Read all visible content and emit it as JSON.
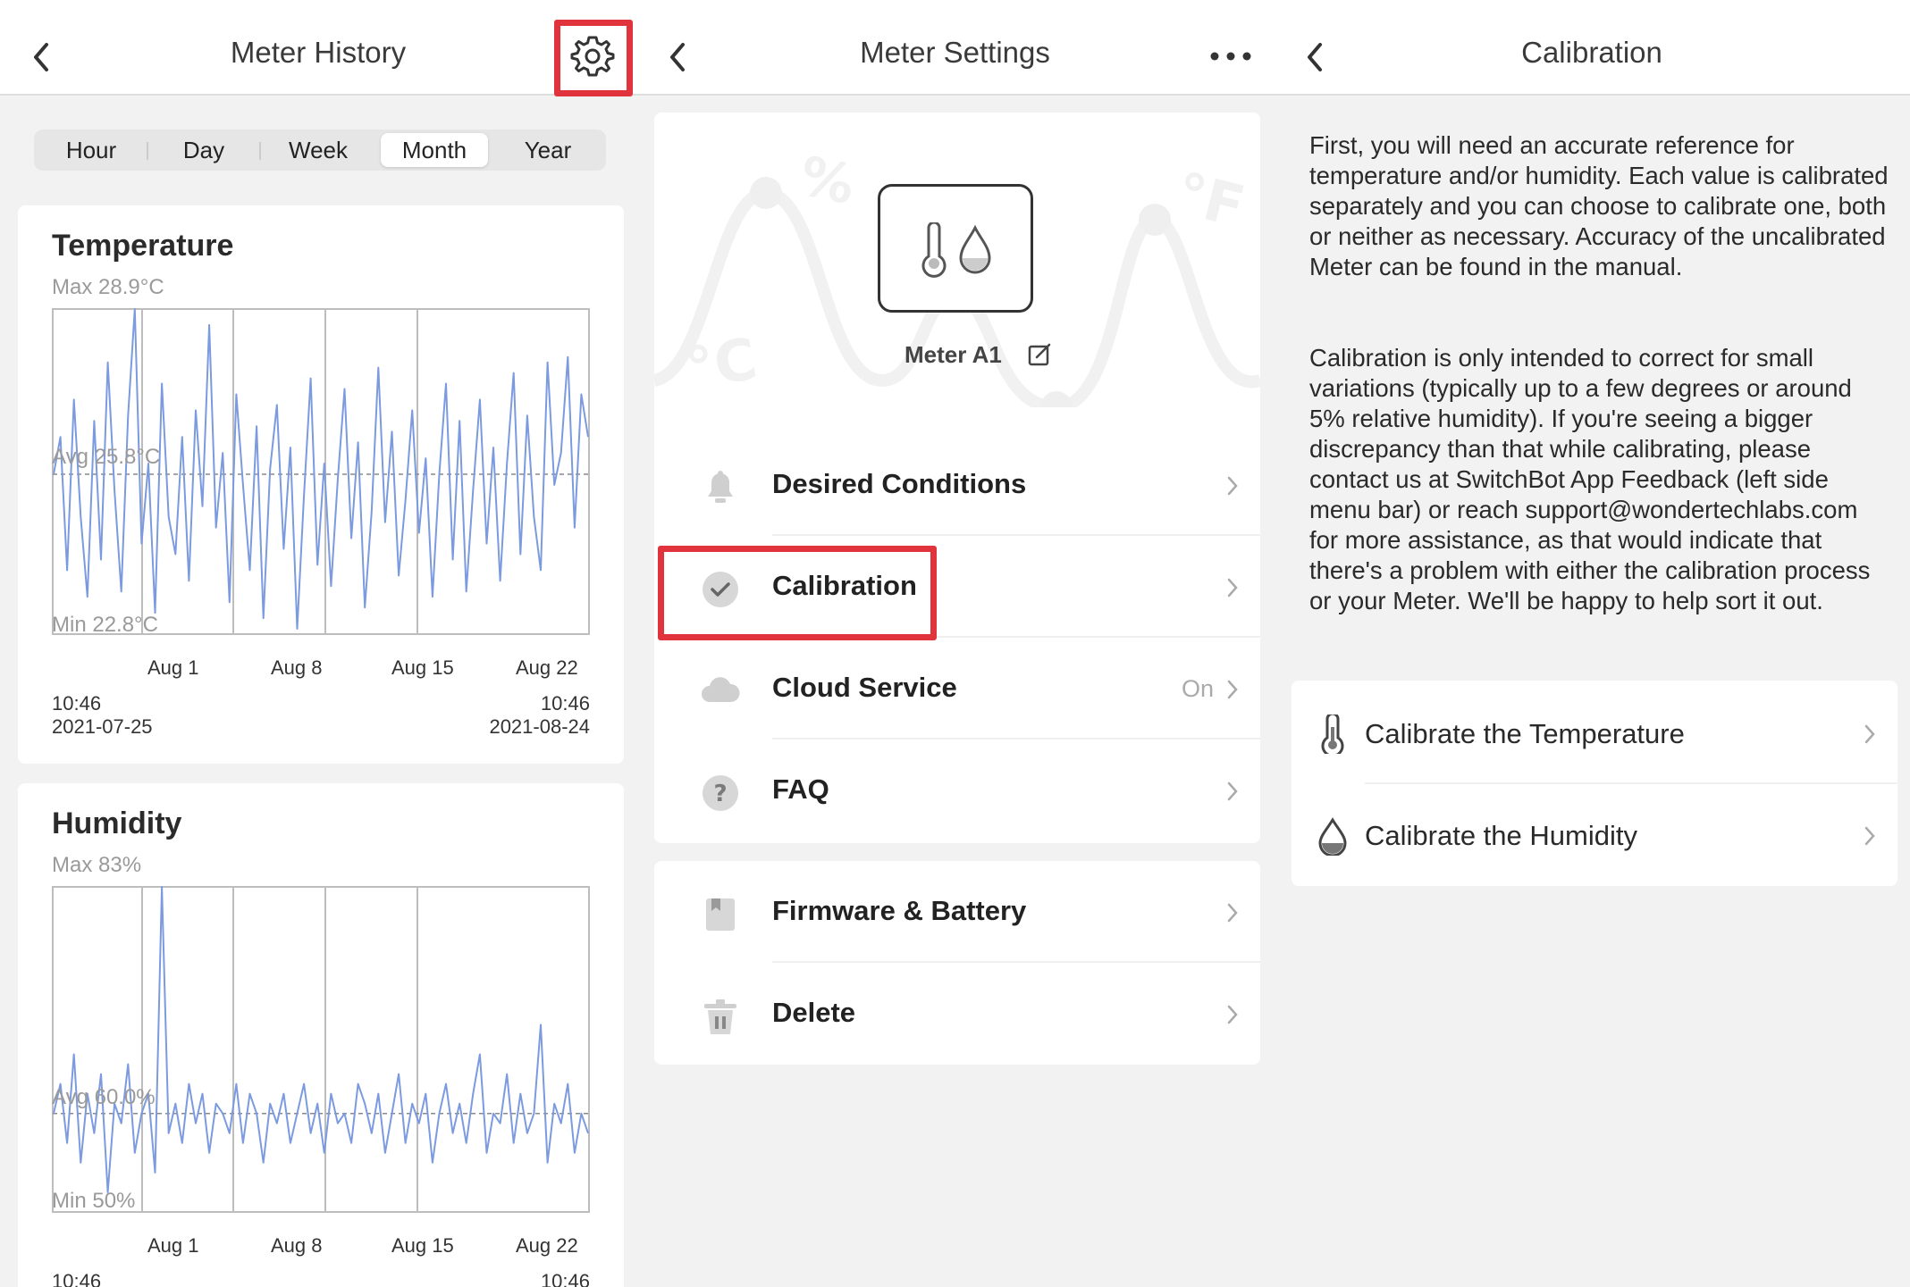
{
  "history": {
    "title": "Meter History",
    "tabs": [
      {
        "label": "Hour",
        "active": false
      },
      {
        "label": "Day",
        "active": false
      },
      {
        "label": "Week",
        "active": false
      },
      {
        "label": "Month",
        "active": true
      },
      {
        "label": "Year",
        "active": false
      }
    ],
    "temperature": {
      "title": "Temperature",
      "max_label": "Max 28.9°C",
      "avg_label": "Avg 25.8°C",
      "min_label": "Min 22.8°C",
      "start_time": "10:46",
      "start_date": "2021-07-25",
      "end_time": "10:46",
      "end_date": "2021-08-24"
    },
    "humidity": {
      "title": "Humidity",
      "max_label": "Max 83%",
      "avg_label": "Avg 60.0%",
      "min_label": "Min 50%",
      "start_time": "10:46",
      "end_time": "10:46"
    },
    "x_ticks": [
      "Aug 1",
      "Aug 8",
      "Aug 15",
      "Aug 22"
    ]
  },
  "settings": {
    "title": "Meter Settings",
    "device_name": "Meter A1",
    "rows": [
      {
        "label": "Desired Conditions",
        "icon": "bell-icon",
        "value": ""
      },
      {
        "label": "Calibration",
        "icon": "check-circle-icon",
        "value": ""
      },
      {
        "label": "Cloud Service",
        "icon": "cloud-icon",
        "value": "On"
      },
      {
        "label": "FAQ",
        "icon": "question-icon",
        "value": ""
      }
    ],
    "rows2": [
      {
        "label": "Firmware & Battery",
        "icon": "firmware-icon"
      },
      {
        "label": "Delete",
        "icon": "trash-icon"
      }
    ]
  },
  "calibration": {
    "title": "Calibration",
    "para1": "First, you will need an accurate reference for temperature and/or humidity. Each value is calibrated separately and you can choose to calibrate one, both or neither as necessary. Accuracy of the uncalibrated Meter can be found in the manual.",
    "para2": "Calibration is only intended to correct for small variations (typically up to a few degrees or around 5% relative humidity). If you're seeing a bigger discrepancy than that while calibrating, please contact us at SwitchBot App Feedback (left side menu bar) or reach support@wondertechlabs.com for more assistance, as that would indicate that there's a problem with either the calibration process or your Meter. We'll be happy to help sort it out.",
    "options": [
      {
        "label": "Calibrate the Temperature",
        "icon": "thermometer-icon"
      },
      {
        "label": "Calibrate the Humidity",
        "icon": "droplet-icon"
      }
    ]
  },
  "colors": {
    "highlight": "#e0333c",
    "line": "#7b9ae0",
    "text": "#222222",
    "muted": "#9a9a9a"
  },
  "chart_data": [
    {
      "type": "line",
      "title": "Temperature",
      "x_ticks": [
        "Aug 1",
        "Aug 8",
        "Aug 15",
        "Aug 22"
      ],
      "ylim": [
        22.8,
        28.9
      ],
      "avg": 25.8,
      "series": [
        {
          "values": [
            25.8,
            26.5,
            24.0,
            27.2,
            25.0,
            23.5,
            26.8,
            24.2,
            27.9,
            25.5,
            23.6,
            26.9,
            28.9,
            24.5,
            26.0,
            23.2,
            27.5,
            25.0,
            24.3,
            26.5,
            23.8,
            27.0,
            25.2,
            28.6,
            24.8,
            26.2,
            23.4,
            27.3,
            25.6,
            24.0,
            26.7,
            23.1,
            25.9,
            27.1,
            24.4,
            26.3,
            22.9,
            25.4,
            27.6,
            24.1,
            26.0,
            23.7,
            25.7,
            27.4,
            24.6,
            26.4,
            23.3,
            25.1,
            27.8,
            24.9,
            26.6,
            23.9,
            25.3,
            27.0,
            24.7,
            26.1,
            23.5,
            25.8,
            27.5,
            24.2,
            26.8,
            23.6,
            25.5,
            27.2,
            24.5,
            26.3,
            23.8,
            26.0,
            27.7,
            24.3,
            26.9,
            25.0,
            24.0,
            27.9,
            25.6,
            26.2,
            28.0,
            24.8,
            27.3,
            26.5
          ]
        }
      ]
    },
    {
      "type": "line",
      "title": "Humidity",
      "x_ticks": [
        "Aug 1",
        "Aug 8",
        "Aug 15",
        "Aug 22"
      ],
      "ylim": [
        50,
        83
      ],
      "avg": 60.0,
      "series": [
        {
          "values": [
            60,
            63,
            57,
            66,
            55,
            62,
            58,
            64,
            52,
            61,
            59,
            65,
            56,
            60,
            62,
            54,
            83,
            58,
            61,
            57,
            63,
            59,
            62,
            56,
            61,
            60,
            58,
            63,
            57,
            62,
            60,
            55,
            61,
            59,
            62,
            57,
            60,
            63,
            58,
            61,
            56,
            62,
            59,
            60,
            57,
            63,
            61,
            58,
            62,
            56,
            60,
            64,
            57,
            61,
            59,
            62,
            55,
            60,
            63,
            58,
            61,
            57,
            62,
            66,
            56,
            60,
            59,
            64,
            57,
            62,
            58,
            60,
            69,
            55,
            61,
            59,
            63,
            56,
            60,
            58
          ]
        }
      ]
    }
  ]
}
